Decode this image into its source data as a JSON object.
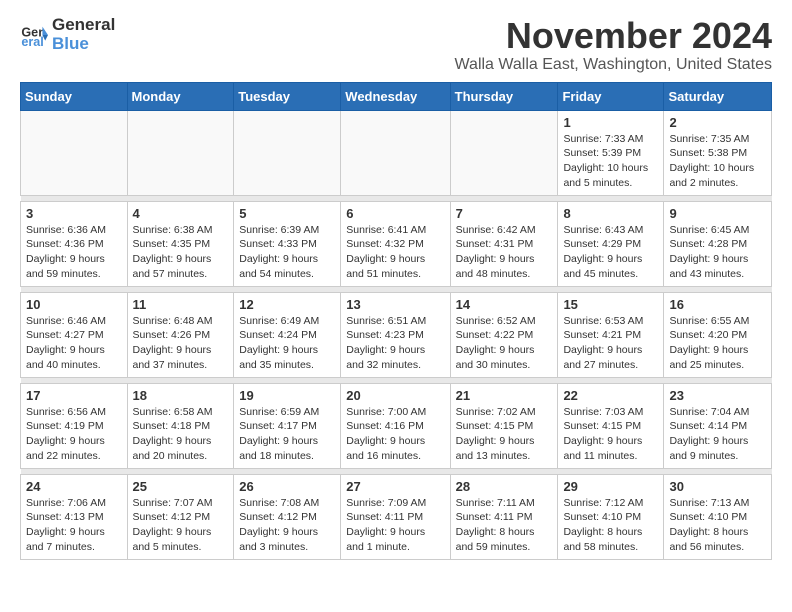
{
  "logo": {
    "line1": "General",
    "line2": "Blue"
  },
  "title": "November 2024",
  "location": "Walla Walla East, Washington, United States",
  "weekdays": [
    "Sunday",
    "Monday",
    "Tuesday",
    "Wednesday",
    "Thursday",
    "Friday",
    "Saturday"
  ],
  "weeks": [
    [
      {
        "day": "",
        "info": ""
      },
      {
        "day": "",
        "info": ""
      },
      {
        "day": "",
        "info": ""
      },
      {
        "day": "",
        "info": ""
      },
      {
        "day": "",
        "info": ""
      },
      {
        "day": "1",
        "info": "Sunrise: 7:33 AM\nSunset: 5:39 PM\nDaylight: 10 hours\nand 5 minutes."
      },
      {
        "day": "2",
        "info": "Sunrise: 7:35 AM\nSunset: 5:38 PM\nDaylight: 10 hours\nand 2 minutes."
      }
    ],
    [
      {
        "day": "3",
        "info": "Sunrise: 6:36 AM\nSunset: 4:36 PM\nDaylight: 9 hours\nand 59 minutes."
      },
      {
        "day": "4",
        "info": "Sunrise: 6:38 AM\nSunset: 4:35 PM\nDaylight: 9 hours\nand 57 minutes."
      },
      {
        "day": "5",
        "info": "Sunrise: 6:39 AM\nSunset: 4:33 PM\nDaylight: 9 hours\nand 54 minutes."
      },
      {
        "day": "6",
        "info": "Sunrise: 6:41 AM\nSunset: 4:32 PM\nDaylight: 9 hours\nand 51 minutes."
      },
      {
        "day": "7",
        "info": "Sunrise: 6:42 AM\nSunset: 4:31 PM\nDaylight: 9 hours\nand 48 minutes."
      },
      {
        "day": "8",
        "info": "Sunrise: 6:43 AM\nSunset: 4:29 PM\nDaylight: 9 hours\nand 45 minutes."
      },
      {
        "day": "9",
        "info": "Sunrise: 6:45 AM\nSunset: 4:28 PM\nDaylight: 9 hours\nand 43 minutes."
      }
    ],
    [
      {
        "day": "10",
        "info": "Sunrise: 6:46 AM\nSunset: 4:27 PM\nDaylight: 9 hours\nand 40 minutes."
      },
      {
        "day": "11",
        "info": "Sunrise: 6:48 AM\nSunset: 4:26 PM\nDaylight: 9 hours\nand 37 minutes."
      },
      {
        "day": "12",
        "info": "Sunrise: 6:49 AM\nSunset: 4:24 PM\nDaylight: 9 hours\nand 35 minutes."
      },
      {
        "day": "13",
        "info": "Sunrise: 6:51 AM\nSunset: 4:23 PM\nDaylight: 9 hours\nand 32 minutes."
      },
      {
        "day": "14",
        "info": "Sunrise: 6:52 AM\nSunset: 4:22 PM\nDaylight: 9 hours\nand 30 minutes."
      },
      {
        "day": "15",
        "info": "Sunrise: 6:53 AM\nSunset: 4:21 PM\nDaylight: 9 hours\nand 27 minutes."
      },
      {
        "day": "16",
        "info": "Sunrise: 6:55 AM\nSunset: 4:20 PM\nDaylight: 9 hours\nand 25 minutes."
      }
    ],
    [
      {
        "day": "17",
        "info": "Sunrise: 6:56 AM\nSunset: 4:19 PM\nDaylight: 9 hours\nand 22 minutes."
      },
      {
        "day": "18",
        "info": "Sunrise: 6:58 AM\nSunset: 4:18 PM\nDaylight: 9 hours\nand 20 minutes."
      },
      {
        "day": "19",
        "info": "Sunrise: 6:59 AM\nSunset: 4:17 PM\nDaylight: 9 hours\nand 18 minutes."
      },
      {
        "day": "20",
        "info": "Sunrise: 7:00 AM\nSunset: 4:16 PM\nDaylight: 9 hours\nand 16 minutes."
      },
      {
        "day": "21",
        "info": "Sunrise: 7:02 AM\nSunset: 4:15 PM\nDaylight: 9 hours\nand 13 minutes."
      },
      {
        "day": "22",
        "info": "Sunrise: 7:03 AM\nSunset: 4:15 PM\nDaylight: 9 hours\nand 11 minutes."
      },
      {
        "day": "23",
        "info": "Sunrise: 7:04 AM\nSunset: 4:14 PM\nDaylight: 9 hours\nand 9 minutes."
      }
    ],
    [
      {
        "day": "24",
        "info": "Sunrise: 7:06 AM\nSunset: 4:13 PM\nDaylight: 9 hours\nand 7 minutes."
      },
      {
        "day": "25",
        "info": "Sunrise: 7:07 AM\nSunset: 4:12 PM\nDaylight: 9 hours\nand 5 minutes."
      },
      {
        "day": "26",
        "info": "Sunrise: 7:08 AM\nSunset: 4:12 PM\nDaylight: 9 hours\nand 3 minutes."
      },
      {
        "day": "27",
        "info": "Sunrise: 7:09 AM\nSunset: 4:11 PM\nDaylight: 9 hours\nand 1 minute."
      },
      {
        "day": "28",
        "info": "Sunrise: 7:11 AM\nSunset: 4:11 PM\nDaylight: 8 hours\nand 59 minutes."
      },
      {
        "day": "29",
        "info": "Sunrise: 7:12 AM\nSunset: 4:10 PM\nDaylight: 8 hours\nand 58 minutes."
      },
      {
        "day": "30",
        "info": "Sunrise: 7:13 AM\nSunset: 4:10 PM\nDaylight: 8 hours\nand 56 minutes."
      }
    ]
  ]
}
